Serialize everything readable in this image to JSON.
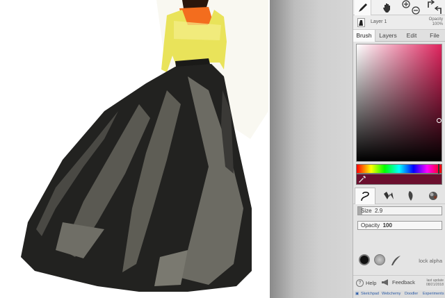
{
  "app": {
    "accent_color": "#6b0f2e",
    "current_color": "#6b0f2e",
    "hue_color": "#e0245e"
  },
  "toolbar": {
    "tools": [
      {
        "name": "brush-tool-icon",
        "active": true
      },
      {
        "name": "hand-pan-icon",
        "active": false
      },
      {
        "name": "zoom-in-icon",
        "active": false
      },
      {
        "name": "zoom-out-icon",
        "active": false
      },
      {
        "name": "undo-icon",
        "active": false
      },
      {
        "name": "redo-icon",
        "active": false
      }
    ]
  },
  "layer": {
    "name": "Layer 1",
    "opacity_label": "Opacity",
    "opacity_value": "100%"
  },
  "tabs": [
    {
      "label": "Brush",
      "active": true
    },
    {
      "label": "Layers",
      "active": false
    },
    {
      "label": "Edit",
      "active": false
    },
    {
      "label": "File",
      "active": false
    }
  ],
  "brush": {
    "types": [
      "pen-brush-icon",
      "calligraphy-brush-icon",
      "feather-brush-icon",
      "blend-brush-icon"
    ],
    "size_label": "Size",
    "size_value": "2.9",
    "size_fraction": 0.05,
    "opacity_label": "Opacity",
    "opacity_value": "100",
    "opacity_fraction": 1.0,
    "presets": [
      "solid-round-preset",
      "textured-preset",
      "feather-preset"
    ],
    "lock_alpha": "lock alpha"
  },
  "footer": {
    "help": "Help",
    "feedback": "Feedback",
    "saved_line1": "last update",
    "saved_line2": "08/21/2018"
  },
  "links": [
    "Sketchpad",
    "Webchemy",
    "Doodler",
    "Experiments"
  ]
}
